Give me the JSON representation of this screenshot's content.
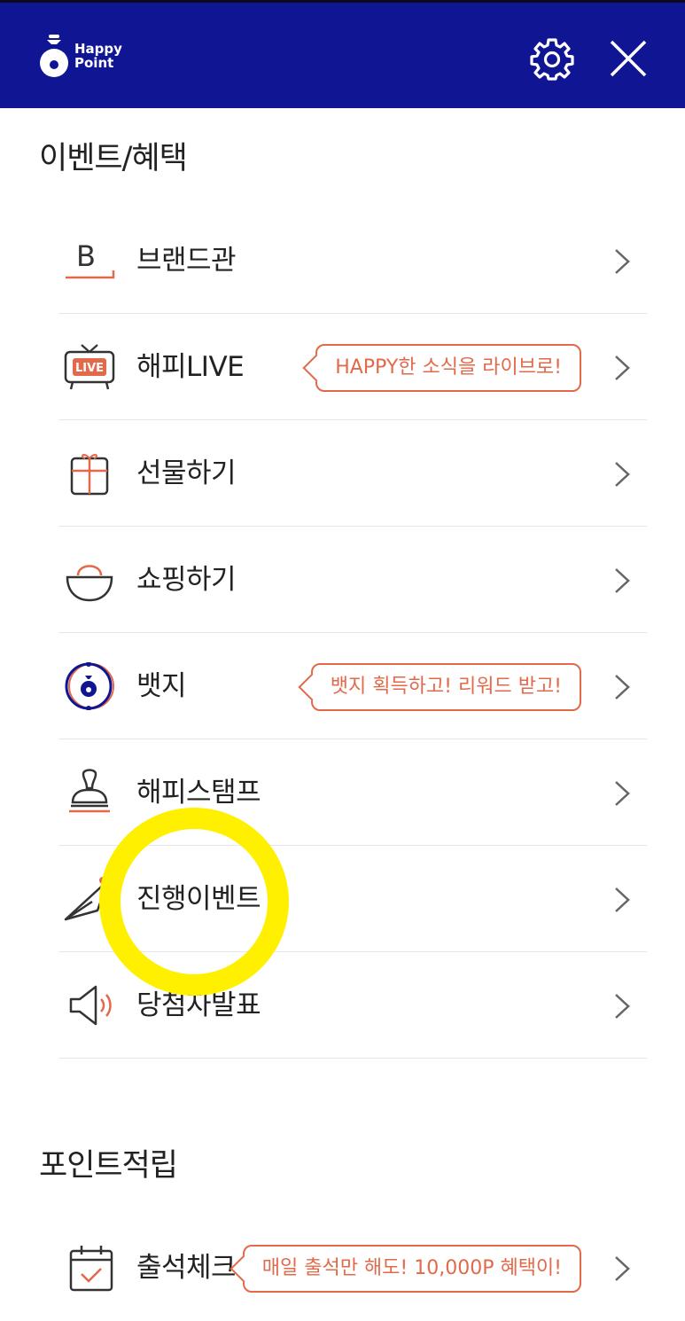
{
  "header": {
    "logo_line1": "Happy",
    "logo_line2": "Point",
    "background": "#101594",
    "settings_icon": "gear-icon",
    "close_icon": "close-icon"
  },
  "sections": {
    "events_title": "이벤트/혜택",
    "points_title": "포인트적립"
  },
  "menu": {
    "brand": {
      "label": "브랜드관",
      "icon": "brand-b-icon"
    },
    "live": {
      "label": "해피LIVE",
      "icon": "live-tv-icon",
      "badge": "LIVE",
      "tag": "HAPPY한 소식을 라이브로!"
    },
    "gift": {
      "label": "선물하기",
      "icon": "gift-box-icon"
    },
    "shopping": {
      "label": "쇼핑하기",
      "icon": "shopping-basket-icon"
    },
    "badge": {
      "label": "뱃지",
      "icon": "badge-medal-icon",
      "tag": "뱃지 획득하고! 리워드 받고!"
    },
    "stamp": {
      "label": "해피스탬프",
      "icon": "stamp-icon"
    },
    "events": {
      "label": "진행이벤트",
      "icon": "paper-plane-icon"
    },
    "winners": {
      "label": "당첨자발표",
      "icon": "megaphone-icon"
    },
    "attendance": {
      "label": "출석체크",
      "icon": "calendar-check-icon",
      "tag": "매일 출석만 해도! 10,000P 혜택이!"
    }
  },
  "colors": {
    "accent": "#e2694a",
    "highlight": "#fff000",
    "navy": "#101594"
  }
}
